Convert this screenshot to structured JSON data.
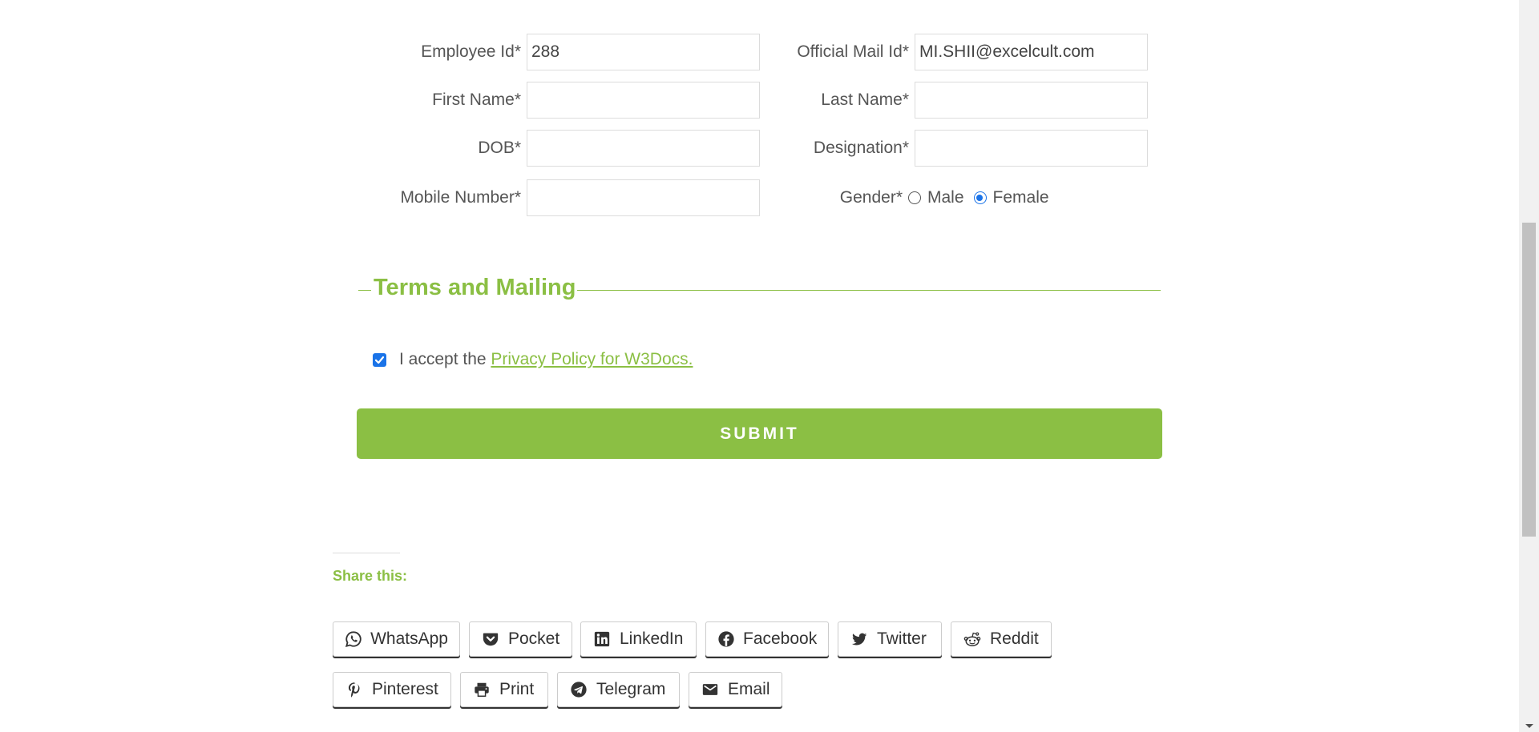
{
  "form": {
    "employee_id_label": "Employee Id*",
    "employee_id_value": "288",
    "official_mail_label": "Official Mail Id*",
    "official_mail_value": "MI.SHII@excelcult.com",
    "first_name_label": "First Name*",
    "first_name_value": "",
    "last_name_label": "Last Name*",
    "last_name_value": "",
    "dob_label": "DOB*",
    "dob_value": "",
    "designation_label": "Designation*",
    "designation_value": "",
    "mobile_label": "Mobile Number*",
    "mobile_value": "",
    "gender_label": "Gender*",
    "gender_options": [
      {
        "label": "Male",
        "checked": false
      },
      {
        "label": "Female",
        "checked": true
      }
    ]
  },
  "terms": {
    "section_title": "Terms and Mailing",
    "accept_text": "I accept the ",
    "privacy_link": "Privacy Policy for W3Docs.",
    "accepted": true
  },
  "submit": {
    "label": "SUBMIT"
  },
  "share": {
    "title": "Share this:",
    "buttons": [
      {
        "label": "WhatsApp",
        "icon": "whatsapp-icon"
      },
      {
        "label": "Pocket",
        "icon": "pocket-icon"
      },
      {
        "label": "LinkedIn",
        "icon": "linkedin-icon"
      },
      {
        "label": "Facebook",
        "icon": "facebook-icon"
      },
      {
        "label": "Twitter",
        "icon": "twitter-icon"
      },
      {
        "label": "Reddit",
        "icon": "reddit-icon"
      },
      {
        "label": "Pinterest",
        "icon": "pinterest-icon"
      },
      {
        "label": "Print",
        "icon": "print-icon"
      },
      {
        "label": "Telegram",
        "icon": "telegram-icon"
      },
      {
        "label": "Email",
        "icon": "email-icon"
      }
    ]
  },
  "colors": {
    "accent": "#8bbf44",
    "checkbox": "#1a73e8",
    "label_text": "#555555"
  }
}
